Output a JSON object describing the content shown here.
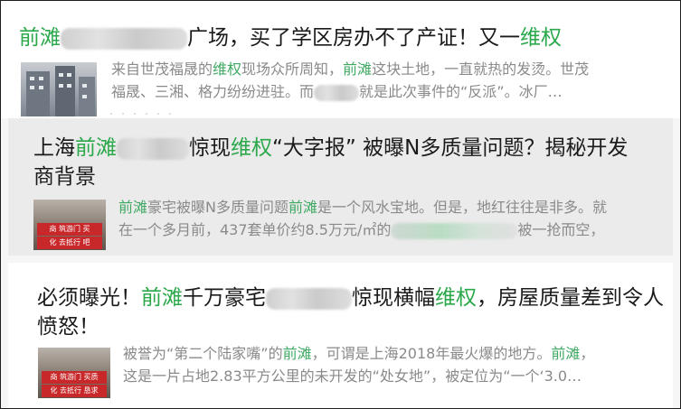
{
  "results": [
    {
      "title_parts": [
        {
          "text": "前滩",
          "kw": true
        },
        {
          "blur": 140
        },
        {
          "text": "广场，买了学区房办不了产证！又一",
          "kw": false
        },
        {
          "text": "维权",
          "kw": true
        }
      ],
      "snippet_lines": [
        [
          {
            "text": "来自世茂福晟的",
            "kw": false
          },
          {
            "text": "维权",
            "kw": true
          },
          {
            "text": "现场众所周知，",
            "kw": false
          },
          {
            "text": "前滩",
            "kw": true
          },
          {
            "text": "这块土地，一直就热的发烫。世茂",
            "kw": false
          }
        ],
        [
          {
            "text": "福晟、三湘、格力纷纷进驻。而",
            "kw": false
          },
          {
            "blur": 50
          },
          {
            "text": "就是此次事件的“反派”。冰厂…",
            "kw": false
          }
        ]
      ],
      "truncated_line": "· · · · · ·",
      "thumbnail": "building-photo"
    },
    {
      "title_lines": [
        [
          {
            "text": "上海",
            "kw": false
          },
          {
            "text": "前滩",
            "kw": true
          },
          {
            "blur": 80
          },
          {
            "text": "惊现",
            "kw": false
          },
          {
            "text": "维权",
            "kw": true
          },
          {
            "text": "“大字报” 被曝N多质量问题？揭秘开发",
            "kw": false
          }
        ],
        [
          {
            "text": "商背景",
            "kw": false
          }
        ]
      ],
      "snippet_lines": [
        [
          {
            "text": "前滩",
            "kw": true
          },
          {
            "text": "豪宅被曝N多质量问题",
            "kw": false
          },
          {
            "text": "前滩",
            "kw": true
          },
          {
            "text": "是一个风水宝地。但是，地红往往是非多。就",
            "kw": false
          }
        ],
        [
          {
            "text": "在一个多月前，437套单价约8.5万元/㎡的",
            "kw": false
          },
          {
            "blur": 140,
            "green": true
          },
          {
            "text": "被一抢而空，",
            "kw": false
          }
        ]
      ],
      "thumbnail": "banner-photo",
      "banner_text": [
        "商 筑游门 买",
        "化 去抵行 吧"
      ]
    },
    {
      "title_lines": [
        [
          {
            "text": "必须曝光！",
            "kw": false
          },
          {
            "text": "前滩",
            "kw": true
          },
          {
            "text": "千万豪宅",
            "kw": false
          },
          {
            "blur": 95
          },
          {
            "text": "惊现横幅",
            "kw": false
          },
          {
            "text": "维权",
            "kw": true
          },
          {
            "text": "，房屋质量差到令人",
            "kw": false
          }
        ],
        [
          {
            "text": "愤怒！",
            "kw": false
          }
        ]
      ],
      "snippet_lines": [
        [
          {
            "text": "被誉为“第二个陆家嘴”的",
            "kw": false
          },
          {
            "text": "前滩",
            "kw": true
          },
          {
            "text": "，可谓是上海2018年最火爆的地方。",
            "kw": false
          },
          {
            "text": "前滩",
            "kw": true
          },
          {
            "text": "，",
            "kw": false
          }
        ],
        [
          {
            "text": "这是一片占地2.83平方公里的未开发的“处女地”，被定位为“一个‘3.0…",
            "kw": false
          }
        ]
      ],
      "thumbnail": "banner-photo",
      "banner_text": [
        "商 筑游门 买质",
        "化 去抵行 恳求"
      ]
    }
  ],
  "colors": {
    "keyword": "#2aa84a",
    "snippet": "#8a8a8a",
    "title": "#1a1a1a",
    "selected_bg": "#ebebeb"
  }
}
